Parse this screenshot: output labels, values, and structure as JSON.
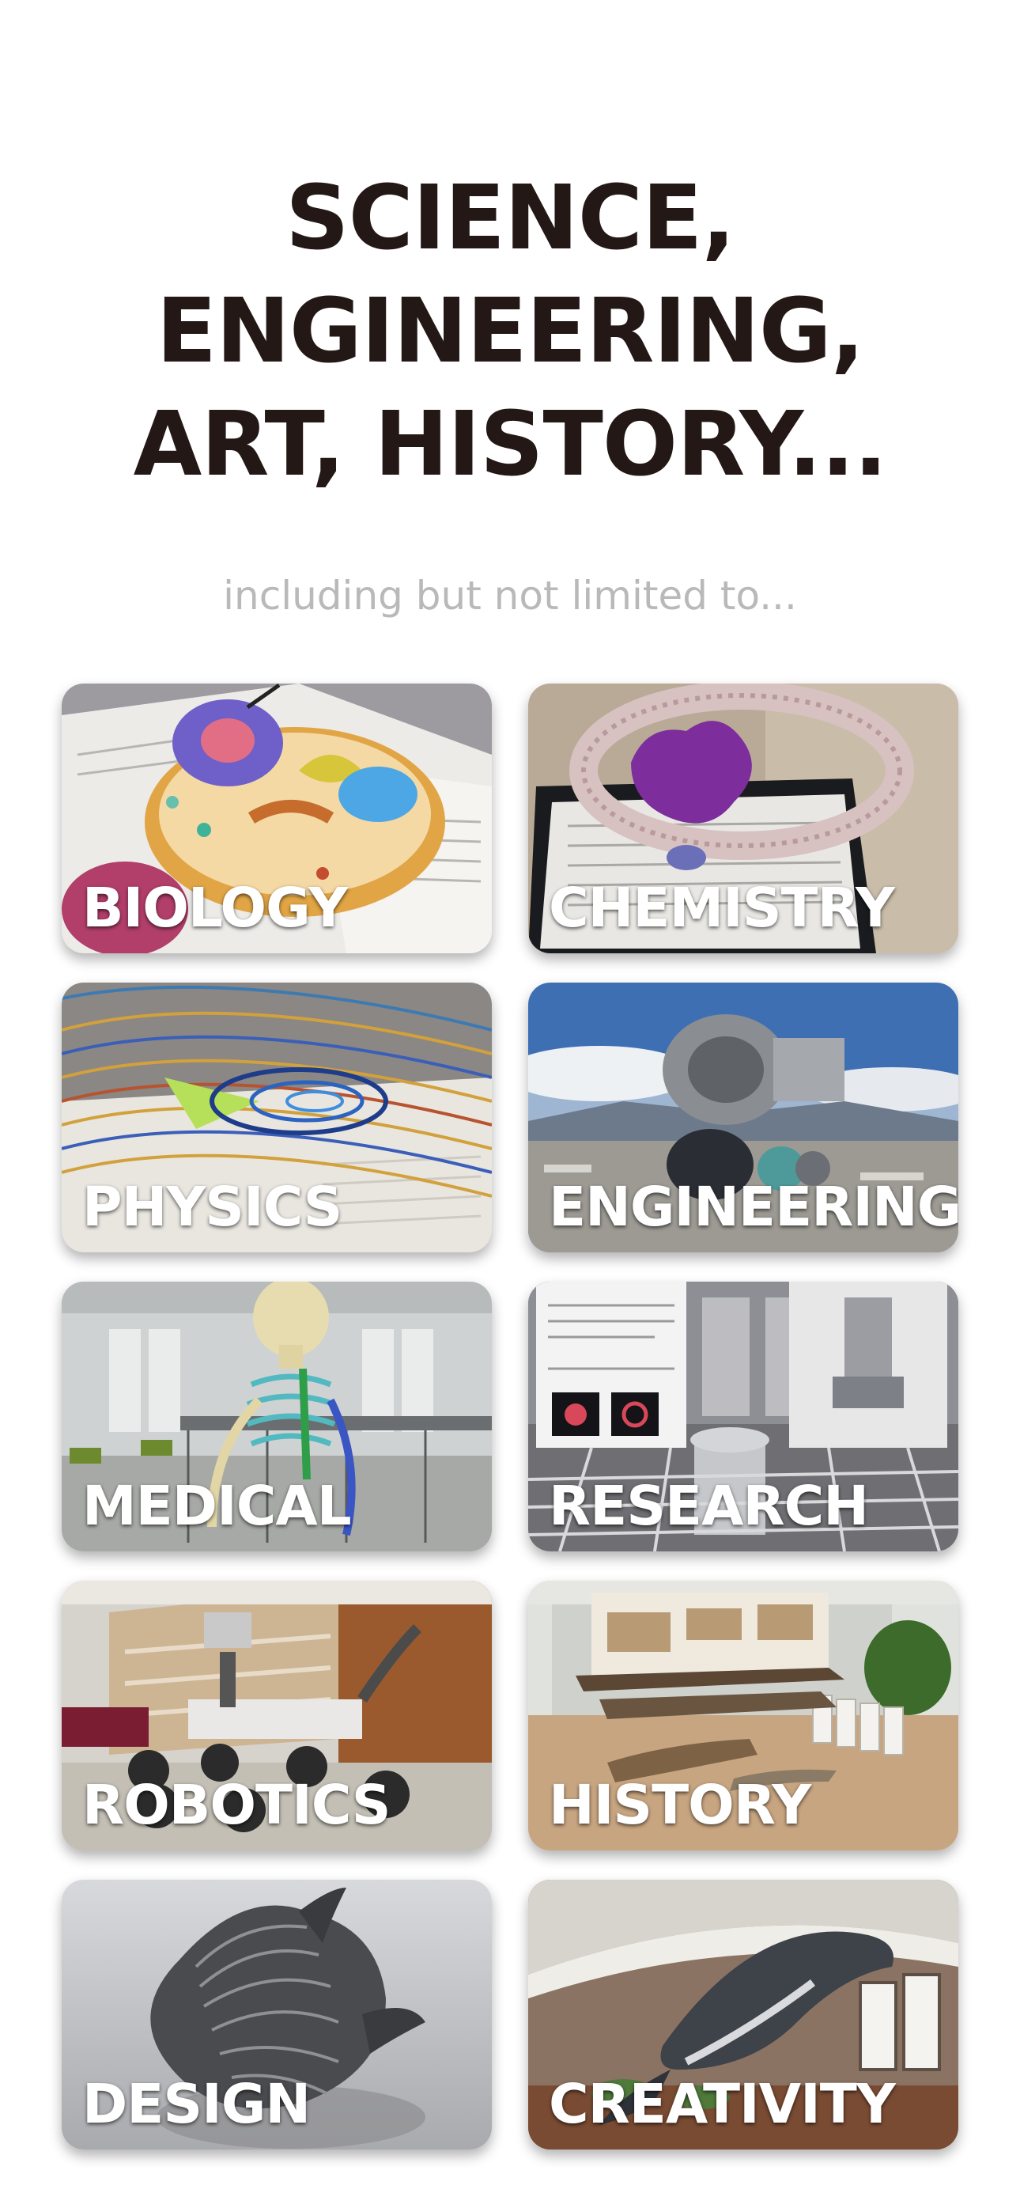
{
  "header": {
    "headline_lines": [
      "SCIENCE,",
      "ENGINEERING,",
      "ART, HISTORY..."
    ],
    "subtitle": "including but not limited to..."
  },
  "categories": [
    {
      "label": "BIOLOGY",
      "image": "animal-cell-model-icon"
    },
    {
      "label": "CHEMISTRY",
      "image": "membrane-protein-model-icon"
    },
    {
      "label": "PHYSICS",
      "image": "airflow-streamlines-icon"
    },
    {
      "label": "ENGINEERING",
      "image": "jet-engine-model-icon"
    },
    {
      "label": "MEDICAL",
      "image": "skeleton-model-icon"
    },
    {
      "label": "RESEARCH",
      "image": "research-poster-model-icon"
    },
    {
      "label": "ROBOTICS",
      "image": "mars-rover-model-icon"
    },
    {
      "label": "HISTORY",
      "image": "canoe-artifacts-icon"
    },
    {
      "label": "DESIGN",
      "image": "twisted-sculpture-icon"
    },
    {
      "label": "CREATIVITY",
      "image": "whale-model-icon"
    }
  ]
}
